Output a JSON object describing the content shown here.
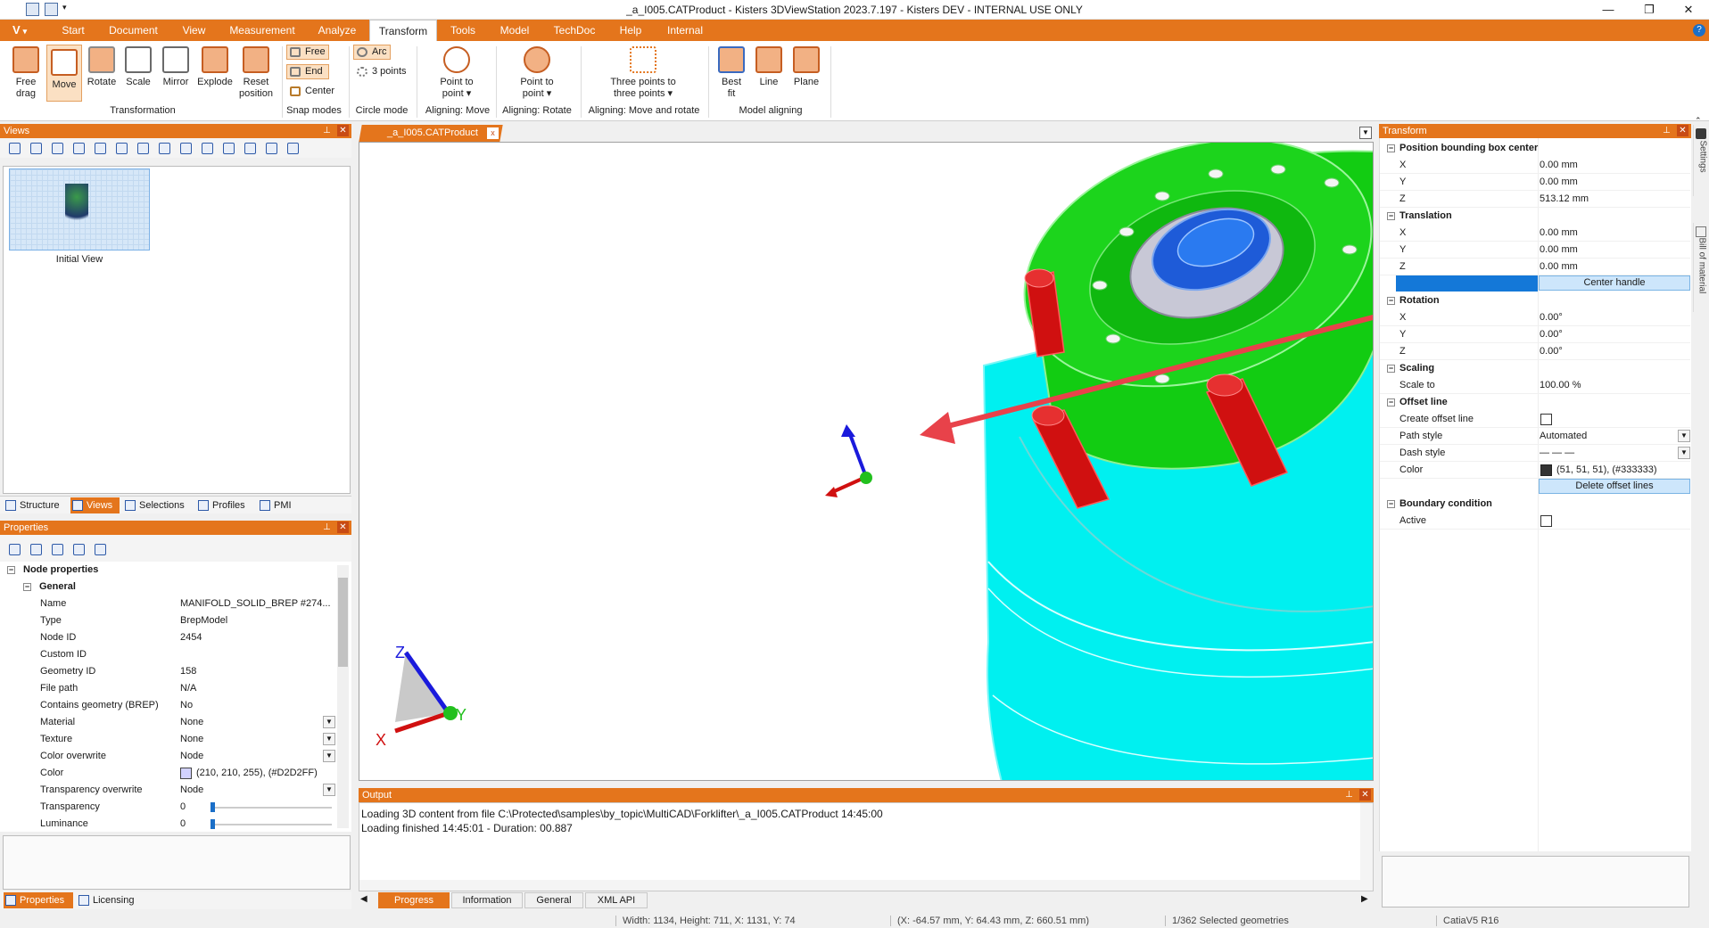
{
  "window": {
    "title": "_a_I005.CATProduct - Kisters 3DViewStation 2023.7.197 - Kisters DEV - INTERNAL USE ONLY",
    "minimize": "—",
    "maximize": "❐",
    "close": "✕"
  },
  "menu": {
    "app_button": "V",
    "tabs": [
      "Start",
      "Document",
      "View",
      "Measurement",
      "Analyze",
      "Transform",
      "Tools",
      "Model",
      "TechDoc",
      "Help",
      "Internal"
    ],
    "active": "Transform",
    "help": "?"
  },
  "ribbon": {
    "transformation": {
      "label": "Transformation",
      "buttons": [
        "Free drag",
        "Move",
        "Rotate",
        "Scale",
        "Mirror",
        "Explode",
        "Reset position"
      ]
    },
    "snap_modes": {
      "label": "Snap modes",
      "free": "Free",
      "end": "End",
      "center": "Center"
    },
    "circle_mode": {
      "label": "Circle mode",
      "arc": "Arc",
      "three_points": "3 points"
    },
    "aligning_move": {
      "label": "Aligning: Move",
      "button": "Point to point ▾"
    },
    "aligning_rotate": {
      "label": "Aligning: Rotate",
      "button": "Point to point ▾"
    },
    "aligning_move_rotate": {
      "label": "Aligning: Move and rotate",
      "button": "Three points to three points ▾"
    },
    "model_aligning": {
      "label": "Model aligning",
      "buttons": [
        "Best fit",
        "Line",
        "Plane"
      ]
    }
  },
  "views_panel": {
    "title": "Views",
    "thumbnail_label": "Initial View",
    "tabs": [
      "Structure",
      "Views",
      "Selections",
      "Profiles",
      "PMI"
    ],
    "active_tab": "Views"
  },
  "properties_panel": {
    "title": "Properties",
    "section": "Node properties",
    "group": "General",
    "rows": [
      {
        "k": "Name",
        "v": "MANIFOLD_SOLID_BREP #274..."
      },
      {
        "k": "Type",
        "v": "BrepModel"
      },
      {
        "k": "Node ID",
        "v": "2454"
      },
      {
        "k": "Custom ID",
        "v": ""
      },
      {
        "k": "Geometry ID",
        "v": "158"
      },
      {
        "k": "File path",
        "v": "N/A"
      },
      {
        "k": "Contains geometry (BREP)",
        "v": "No"
      },
      {
        "k": "Material",
        "v": "None"
      },
      {
        "k": "Texture",
        "v": "None"
      },
      {
        "k": "Color overwrite",
        "v": "Node"
      },
      {
        "k": "Color",
        "v": "(210, 210, 255), (#D2D2FF)"
      },
      {
        "k": "Transparency overwrite",
        "v": "Node"
      },
      {
        "k": "Transparency",
        "v": "0"
      },
      {
        "k": "Luminance",
        "v": "0"
      }
    ],
    "color_swatch": "#D2D2FF",
    "tabs": [
      "Properties",
      "Licensing"
    ],
    "active_tab": "Properties"
  },
  "document": {
    "tab": "_a_I005.CATProduct",
    "close": "x"
  },
  "viewport": {
    "triad": {
      "x": "X",
      "y": "Y",
      "z": "Z"
    }
  },
  "output": {
    "title": "Output",
    "lines": [
      "Loading 3D content from file C:\\Protected\\samples\\by_topic\\MultiCAD\\Forklifter\\_a_I005.CATProduct 14:45:00",
      "Loading finished 14:45:01 - Duration: 00.887"
    ],
    "tabs": [
      "Progress",
      "Information",
      "General",
      "XML API"
    ],
    "active_tab": "Progress"
  },
  "transform_panel": {
    "title": "Transform",
    "sections": [
      {
        "title": "Position bounding box center",
        "rows": [
          {
            "k": "X",
            "v": "0.00 mm"
          },
          {
            "k": "Y",
            "v": "0.00 mm"
          },
          {
            "k": "Z",
            "v": "513.12 mm"
          }
        ]
      },
      {
        "title": "Translation",
        "rows": [
          {
            "k": "X",
            "v": "0.00 mm"
          },
          {
            "k": "Y",
            "v": "0.00 mm"
          },
          {
            "k": "Z",
            "v": "0.00 mm"
          }
        ]
      },
      {
        "title": "Rotation",
        "rows": [
          {
            "k": "X",
            "v": "0.00°"
          },
          {
            "k": "Y",
            "v": "0.00°"
          },
          {
            "k": "Z",
            "v": "0.00°"
          }
        ]
      },
      {
        "title": "Scaling",
        "rows": [
          {
            "k": "Scale to",
            "v": "100.00 %"
          }
        ]
      },
      {
        "title": "Offset line",
        "rows": [
          {
            "k": "Create offset line",
            "v": ""
          },
          {
            "k": "Path style",
            "v": "Automated"
          },
          {
            "k": "Dash style",
            "v": "— — —"
          },
          {
            "k": "Color",
            "v": "(51, 51, 51), (#333333)"
          }
        ]
      },
      {
        "title": "Boundary condition",
        "rows": [
          {
            "k": "Active",
            "v": ""
          }
        ]
      }
    ],
    "center_handle": "Center handle",
    "delete_offset": "Delete offset lines",
    "offset_color": "#333333"
  },
  "side_tabs": [
    "Settings",
    "Bill of material"
  ],
  "status": {
    "size": "Width: 1134, Height: 711, X: 1131, Y: 74",
    "coords": "(X: -64.57 mm, Y: 64.43 mm, Z: 660.51 mm)",
    "selected": "1/362 Selected geometries",
    "format": "CatiaV5 R16"
  },
  "colors": {
    "accent": "#E4751C",
    "green": "#22C01E",
    "cyan": "#00F0F0",
    "red": "#D01010",
    "blue": "#1E5BD8",
    "arrow": "#E8424A"
  }
}
